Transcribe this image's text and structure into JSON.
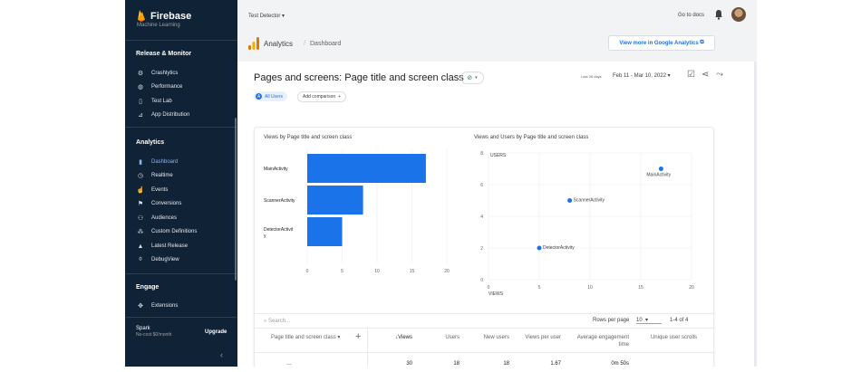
{
  "sidebar": {
    "brand": "Firebase",
    "cut_item": "Machine Learning",
    "sections": [
      {
        "title": "Release & Monitor",
        "items": [
          {
            "label": "Crashlytics",
            "icon": "crashlytics-icon"
          },
          {
            "label": "Performance",
            "icon": "performance-icon"
          },
          {
            "label": "Test Lab",
            "icon": "test-lab-icon"
          },
          {
            "label": "App Distribution",
            "icon": "app-distribution-icon"
          }
        ]
      },
      {
        "title": "Analytics",
        "items": [
          {
            "label": "Dashboard",
            "icon": "bar-chart-icon",
            "active": true
          },
          {
            "label": "Realtime",
            "icon": "clock-icon"
          },
          {
            "label": "Events",
            "icon": "events-icon"
          },
          {
            "label": "Conversions",
            "icon": "flag-icon"
          },
          {
            "label": "Audiences",
            "icon": "audiences-icon"
          },
          {
            "label": "Custom Definitions",
            "icon": "custom-definitions-icon"
          },
          {
            "label": "Latest Release",
            "icon": "latest-release-icon"
          },
          {
            "label": "DebugView",
            "icon": "debug-icon"
          }
        ]
      },
      {
        "title": "Engage",
        "items": [
          {
            "label": "Extensions",
            "icon": "extensions-icon"
          }
        ]
      }
    ],
    "plan_name": "Spark",
    "plan_sub": "No-cost $0/month",
    "upgrade": "Upgrade",
    "collapse_icon": "chevron-left-icon"
  },
  "topbar": {
    "project": "Test Detector",
    "docs": "Go to docs"
  },
  "analytics_header": {
    "title": "Analytics",
    "crumb": "Dashboard",
    "view_more": "View more in Google Analytics"
  },
  "report": {
    "title": "Pages and screens: Page title and screen class",
    "date_small": "Last 28 days",
    "date_range": "Feb 11 - Mar 10, 2022",
    "chip_all": "All Users",
    "chip_all_letter": "A",
    "chip_add": "Add comparison"
  },
  "bar_chart": {
    "title": "Views by Page title and screen class",
    "chart_data": {
      "type": "bar",
      "categories": [
        "MainActivity",
        "ScannerActivity",
        "DetectorActivit\ny"
      ],
      "values": [
        17,
        8,
        5
      ],
      "xlim": [
        0,
        20
      ],
      "xticks": [
        "0",
        "5",
        "10",
        "15",
        "20"
      ],
      "color": "#1a73e8"
    }
  },
  "scatter_chart": {
    "title": "Views and Users by Page title and screen class",
    "chart_data": {
      "type": "scatter",
      "points": [
        {
          "label": "MainActivity",
          "x": 17,
          "y": 7
        },
        {
          "label": "ScannerActivity",
          "x": 8,
          "y": 5
        },
        {
          "label": "DetectorActivity",
          "x": 5,
          "y": 2
        }
      ],
      "xlim": [
        0,
        20
      ],
      "ylim": [
        0,
        8
      ],
      "xticks": [
        "0",
        "5",
        "10",
        "15",
        "20"
      ],
      "yticks": [
        "0",
        "2",
        "4",
        "6",
        "8"
      ],
      "xlabel": "VIEWS",
      "ylabel": "USERS",
      "color": "#1a73e8"
    }
  },
  "table": {
    "search_placeholder": "Search...",
    "rows_per_page_label": "Rows per page",
    "rows_per_page": "10",
    "range": "1-4 of 4",
    "headers": [
      "Page title and screen class",
      "Views",
      "Users",
      "New users",
      "Views per user",
      "Average engagement time",
      "Unique user scrolls"
    ],
    "totals": [
      "30",
      "18",
      "18",
      "1.67",
      "0m 50s"
    ]
  }
}
